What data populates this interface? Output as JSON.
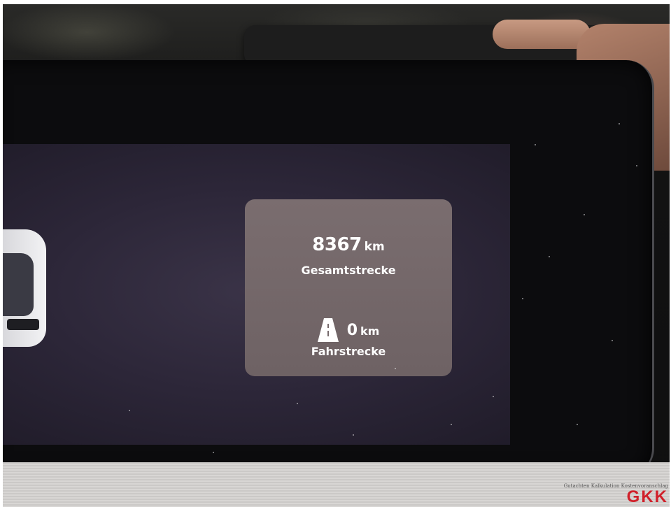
{
  "trip_panel": {
    "total_value": "8367",
    "total_unit": "km",
    "total_label": "Gesamtstrecke",
    "trip_value": "0",
    "trip_unit": "km",
    "trip_label": "Fahrstrecke",
    "trip_icon": "road-icon"
  },
  "watermark": {
    "small_text": "Gutachten Kalkulation Kostenvoranschlag",
    "logo_text": "GKK"
  },
  "colors": {
    "panel_background": "#766a6c",
    "screen_background": "#2c2638",
    "watermark_red": "#d0202a"
  }
}
